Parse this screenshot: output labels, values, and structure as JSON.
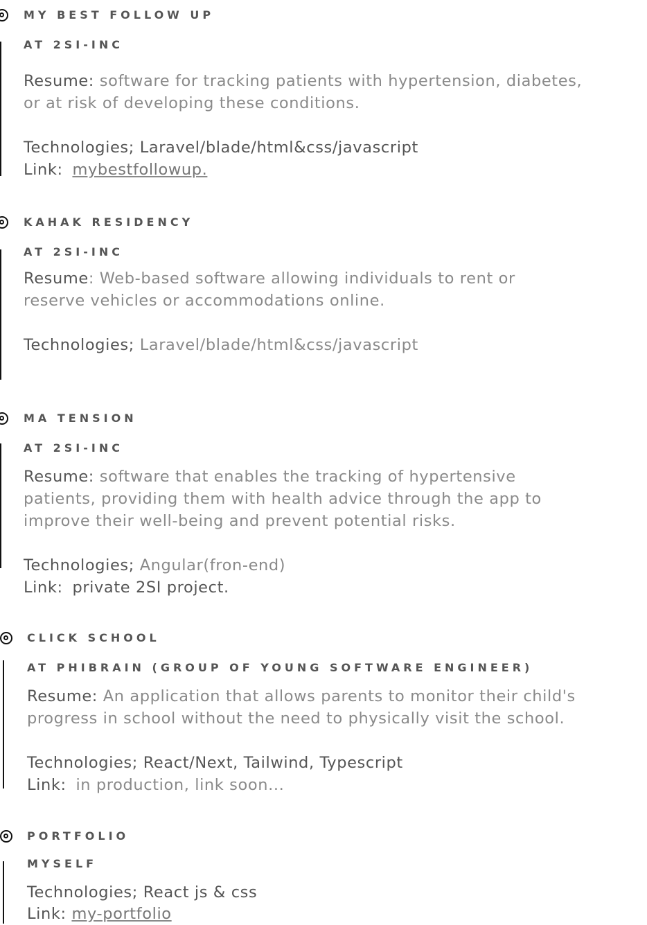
{
  "labels": {
    "resume": "Resume:",
    "resume_no_colon": "Resume",
    "colon": ":",
    "technologies": "Technologies;",
    "link": "Link:"
  },
  "projects": [
    {
      "title": "MY BEST FOLLOW UP",
      "company": "AT 2SI-INC",
      "resume_lines": [
        "software for tracking patients with hypertension, diabetes,",
        "or at risk of developing these conditions."
      ],
      "technologies": "Laravel/blade/html&css/javascript",
      "link": "mybestfollowup."
    },
    {
      "title": "KAHAK RESIDENCY",
      "company": "AT 2SI-INC",
      "resume_lines": [
        "Web-based software allowing individuals to rent or",
        "reserve vehicles or accommodations online."
      ],
      "technologies": "Laravel/blade/html&css/javascript"
    },
    {
      "title": "MA TENSION",
      "company": "AT 2SI-INC",
      "resume_lines": [
        "software that enables the tracking of hypertensive",
        "patients, providing them with health advice through the app to",
        "improve their well-being and prevent potential risks."
      ],
      "technologies": "Angular(fron-end)",
      "link": "private 2SI project."
    },
    {
      "title": "CLICK SCHOOL",
      "company": "AT PHIBRAIN (GROUP OF YOUNG SOFTWARE ENGINEER)",
      "resume_lines": [
        "An application that allows parents to monitor their child's",
        "progress in school without the need to physically visit the school."
      ],
      "technologies": "React/Next, Tailwind, Typescript",
      "link": "in production, link soon..."
    },
    {
      "title": "PORTFOLIO",
      "company": "MYSELF",
      "technologies": "React js & css",
      "link": "my-portfolio"
    }
  ]
}
